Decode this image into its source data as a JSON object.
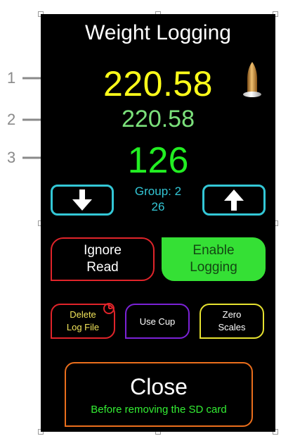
{
  "callouts": [
    "1",
    "2",
    "3"
  ],
  "screen": {
    "title": "Weight Logging",
    "weight_primary": "220.58",
    "weight_secondary": "220.58",
    "count": "126",
    "group_label": "Group: 2",
    "group_value": "26",
    "buttons": {
      "ignore_line1": "Ignore",
      "ignore_line2": "Read",
      "enable_line1": "Enable",
      "enable_line2": "Logging",
      "delete_line1": "Delete",
      "delete_line2": "Log File",
      "use_cup": "Use Cup",
      "zero_line1": "Zero",
      "zero_line2": "Scales",
      "close": "Close",
      "close_sub": "Before removing the SD card"
    }
  },
  "icons": {
    "bullet": "bullet-icon",
    "down": "down-arrow-icon",
    "up": "up-arrow-icon",
    "clock": "clock-icon"
  },
  "colors": {
    "weight_primary": "#ffff1a",
    "weight_secondary": "#7be07b",
    "count": "#22ee22",
    "accent_cyan": "#33c7d6",
    "red": "#e0242a",
    "green": "#35e035",
    "purple": "#7b22d6",
    "yellow": "#e6e230",
    "orange": "#ea6e1c"
  }
}
